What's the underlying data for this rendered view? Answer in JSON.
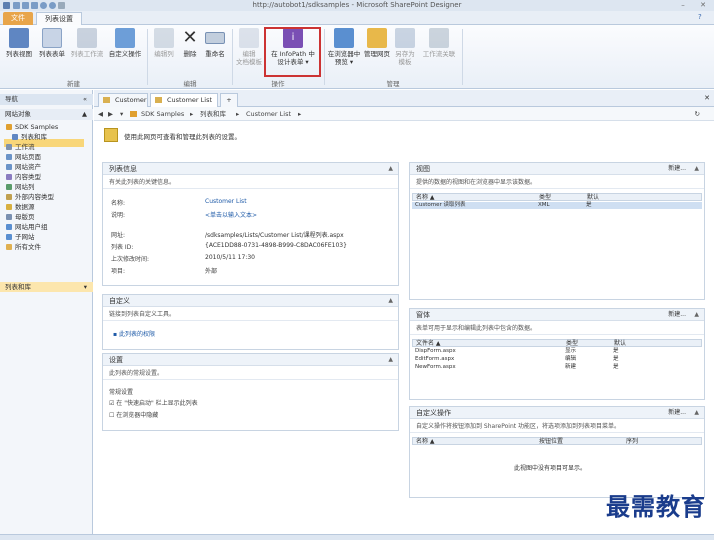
{
  "window": {
    "title": "http://autobot1/sdksamples - Microsoft SharePoint Designer",
    "help": "?",
    "minimize": "–",
    "close": "✕"
  },
  "ribbon_tabs": [
    "文件",
    "列表设置"
  ],
  "ribbon": {
    "buttons": [
      "列表视图",
      "列表表单",
      "列表工作流",
      "自定义操作",
      "编辑列",
      "删除",
      "重命名",
      "编辑\n文档模板",
      "在 InfoPath 中\n设计表单 ▾",
      "在浏览器中\n预览 ▾",
      "管理网页",
      "另存为\n模板",
      "工作流关联"
    ],
    "groups": [
      "新建",
      "编辑",
      "操作",
      "管理"
    ]
  },
  "nav": {
    "header": "导航",
    "section": "网站对象",
    "items": [
      "SDK Samples",
      "列表和库",
      "工作流",
      "网站页面",
      "网站资产",
      "内容类型",
      "网站列",
      "外部内容类型",
      "数据源",
      "母版页",
      "网站用户组",
      "子网站",
      "所有文件"
    ],
    "footer": "列表和库"
  },
  "doc_tabs": [
    "Customer",
    "Customer List"
  ],
  "breadcrumb": [
    "SDK Samples",
    "列表和库",
    "Customer List"
  ],
  "summary": "使用此网页可查看和管理此列表的设置。",
  "list_info": {
    "title": "列表信息",
    "desc": "有关此列表的关键信息。",
    "fields": [
      {
        "label": "名称:",
        "value": "Customer List"
      },
      {
        "label": "说明:",
        "value": "<单击以输入文本>"
      },
      {
        "label": "网址:",
        "value": "/sdksamples/Lists/Customer List/课程列表.aspx"
      },
      {
        "label": "列表 ID:",
        "value": "{ACE1DD88-0731-4898-B999-C8DAC06FE103}"
      },
      {
        "label": "上次修改时间:",
        "value": "2010/5/11 17:30"
      },
      {
        "label": "项目:",
        "value": "外部"
      }
    ]
  },
  "customization": {
    "title": "自定义",
    "desc": "链接到列表自定义工具。",
    "link": "此列表的权限"
  },
  "settings": {
    "title": "设置",
    "desc": "此列表的常规设置。",
    "heading": "常规设置",
    "options": [
      {
        "label": "在 \"快速启动\" 栏上显示此列表",
        "checked": true
      },
      {
        "label": "在浏览器中隐藏",
        "checked": false
      }
    ]
  },
  "views": {
    "title": "视图",
    "new": "新建...",
    "desc": "提供的数据的视图和在浏览器中显示该数据。",
    "columns": [
      "名称 ▲",
      "类型",
      "默认"
    ],
    "rows": [
      [
        "Customer 读取列表",
        "XML",
        "是"
      ]
    ]
  },
  "forms": {
    "title": "窗体",
    "new": "新建...",
    "desc": "表单可用于显示和编辑此列表中包含的数据。",
    "columns": [
      "文件名 ▲",
      "类型",
      "默认"
    ],
    "rows": [
      [
        "DispForm.aspx",
        "显示",
        "是"
      ],
      [
        "EditForm.aspx",
        "编辑",
        "是"
      ],
      [
        "NewForm.aspx",
        "新建",
        "是"
      ]
    ]
  },
  "custom_actions": {
    "title": "自定义操作",
    "new": "新建...",
    "desc": "自定义操作将按钮添加到 SharePoint 功能区，将选项添加到列表项目菜单。",
    "columns": [
      "名称 ▲",
      "按钮位置",
      "序列"
    ],
    "empty": "此视图中没有项目可显示。"
  },
  "watermark": "最需教育"
}
